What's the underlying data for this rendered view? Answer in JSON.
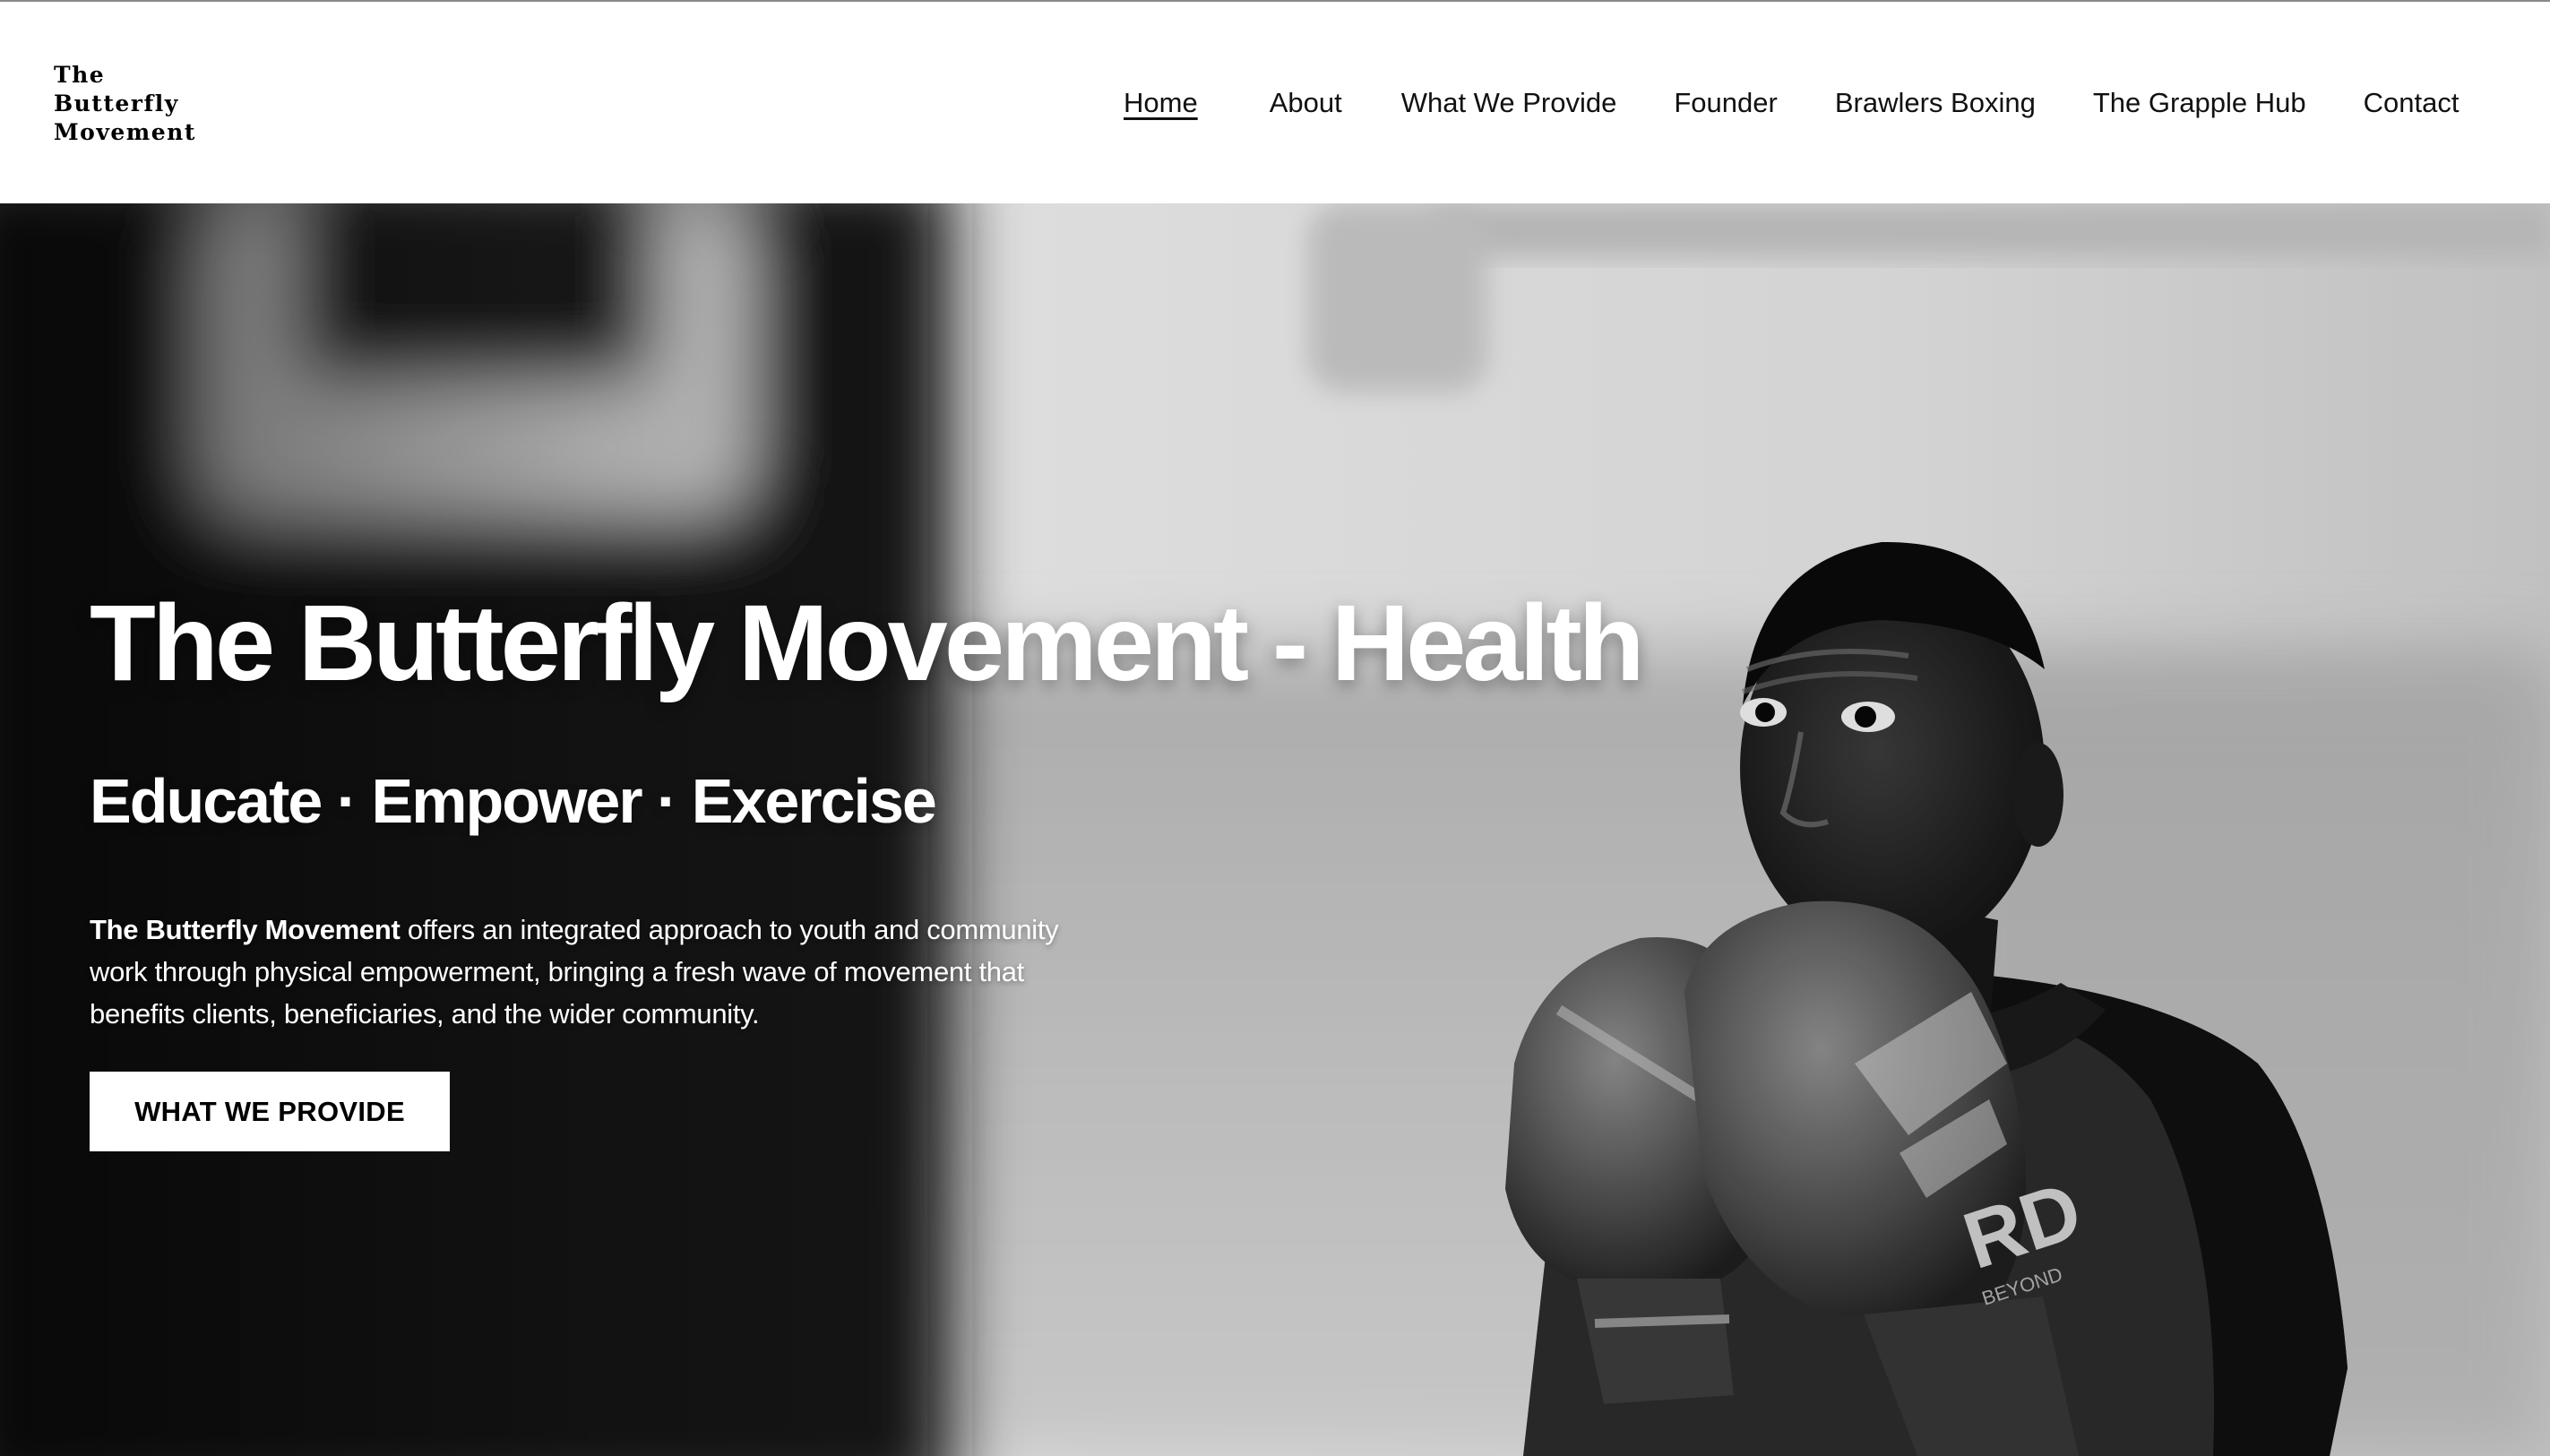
{
  "header": {
    "logo_lines": [
      "The",
      "Butterfly",
      "Movement"
    ],
    "nav": [
      {
        "label": "Home",
        "active": true
      },
      {
        "label": "About",
        "active": false
      },
      {
        "label": "What We Provide",
        "active": false
      },
      {
        "label": "Founder",
        "active": false
      },
      {
        "label": "Brawlers Boxing",
        "active": false
      },
      {
        "label": "The Grapple Hub",
        "active": false
      },
      {
        "label": "Contact",
        "active": false
      }
    ]
  },
  "hero": {
    "title": "The Butterfly Movement - Health",
    "subtitle": "Educate · Empower · Exercise",
    "body_bold": "The Butterfly Movement",
    "body_rest": " offers an integrated approach to youth and community work through physical empowerment, bringing a fresh wave of movement that benefits clients, beneficiaries, and the wider community.",
    "cta_label": "WHAT WE PROVIDE",
    "image_alt": "black-and-white photo of a young boxer with gloves raised in a gym"
  },
  "colors": {
    "header_bg": "#ffffff",
    "hero_text": "#ffffff",
    "button_bg": "#ffffff",
    "button_text": "#000000"
  }
}
